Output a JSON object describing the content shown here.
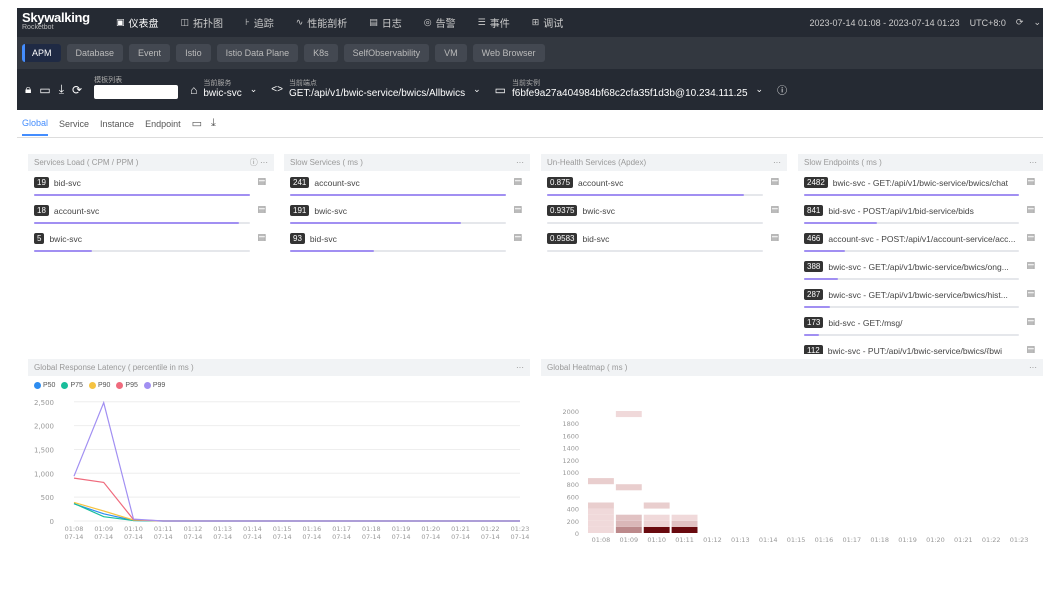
{
  "header": {
    "brand": "Skywalking",
    "brand_sub": "Rocketbot",
    "nav": [
      {
        "icon": "dashboard-icon",
        "glyph": "▣",
        "label": "仪表盘",
        "active": true
      },
      {
        "icon": "topology-icon",
        "glyph": "◫",
        "label": "拓扑图",
        "active": false
      },
      {
        "icon": "trace-icon",
        "glyph": "⊦",
        "label": "追踪",
        "active": false
      },
      {
        "icon": "profile-icon",
        "glyph": "∿",
        "label": "性能剖析",
        "active": false
      },
      {
        "icon": "log-icon",
        "glyph": "▤",
        "label": "日志",
        "active": false
      },
      {
        "icon": "alarm-icon",
        "glyph": "◎",
        "label": "告警",
        "active": false
      },
      {
        "icon": "event-icon",
        "glyph": "☰",
        "label": "事件",
        "active": false
      },
      {
        "icon": "debug-icon",
        "glyph": "⊞",
        "label": "调试",
        "active": false
      }
    ],
    "time_range": "2023-07-14 01:08 - 2023-07-14 01:23",
    "timezone": "UTC+8:0"
  },
  "layers": [
    "APM",
    "Database",
    "Event",
    "Istio",
    "Istio Data Plane",
    "K8s",
    "SelfObservability",
    "VM",
    "Web Browser"
  ],
  "selectors": {
    "service_label": "当前服务",
    "service_value": "bwic-svc",
    "endpoint_label": "当前端点",
    "endpoint_value": "GET:/api/v1/bwic-service/bwics/Allbwics",
    "instance_label": "当前实例",
    "instance_value": "f6bfe9a27a404984bf68c2cfa35f1d3b@10.234.111.25",
    "template_label": "模板列表"
  },
  "tabs": [
    "Global",
    "Service",
    "Instance",
    "Endpoint"
  ],
  "panels": {
    "services_load": {
      "title": "Services Load ( CPM / PPM )",
      "rows": [
        {
          "value": "19",
          "name": "bid-svc",
          "ratio": 1.0
        },
        {
          "value": "18",
          "name": "account-svc",
          "ratio": 0.95
        },
        {
          "value": "5",
          "name": "bwic-svc",
          "ratio": 0.27
        }
      ]
    },
    "slow_services": {
      "title": "Slow Services ( ms )",
      "rows": [
        {
          "value": "241",
          "name": "account-svc",
          "ratio": 1.0
        },
        {
          "value": "191",
          "name": "bwic-svc",
          "ratio": 0.79
        },
        {
          "value": "93",
          "name": "bid-svc",
          "ratio": 0.39
        }
      ]
    },
    "unhealth_services": {
      "title": "Un-Health Services (Apdex)",
      "rows": [
        {
          "value": "0.875",
          "name": "account-svc",
          "ratio": 0.91
        },
        {
          "value": "0.9375",
          "name": "bwic-svc",
          "ratio": 0.0
        },
        {
          "value": "0.9583",
          "name": "bid-svc",
          "ratio": 0.0
        }
      ]
    },
    "slow_endpoints": {
      "title": "Slow Endpoints ( ms )",
      "rows": [
        {
          "value": "2482",
          "name": "bwic-svc - GET:/api/v1/bwic-service/bwics/chat",
          "ratio": 1.0
        },
        {
          "value": "841",
          "name": "bid-svc - POST:/api/v1/bid-service/bids",
          "ratio": 0.34
        },
        {
          "value": "466",
          "name": "account-svc - POST:/api/v1/account-service/acc...",
          "ratio": 0.19
        },
        {
          "value": "388",
          "name": "bwic-svc - GET:/api/v1/bwic-service/bwics/ong...",
          "ratio": 0.16
        },
        {
          "value": "287",
          "name": "bwic-svc - GET:/api/v1/bwic-service/bwics/hist...",
          "ratio": 0.12
        },
        {
          "value": "173",
          "name": "bid-svc - GET:/msg/",
          "ratio": 0.07
        },
        {
          "value": "112",
          "name": "bwic-svc - PUT:/api/v1/bwic-service/bwics/{bwi",
          "ratio": 0.05
        }
      ]
    },
    "latency": {
      "title": "Global Response Latency ( percentile in ms )"
    },
    "heatmap": {
      "title": "Global Heatmap ( ms )"
    }
  },
  "chart_data": [
    {
      "type": "line",
      "title": "Global Response Latency ( percentile in ms )",
      "x": [
        "01:08\n07-14",
        "01:09\n07-14",
        "01:10\n07-14",
        "01:11\n07-14",
        "01:12\n07-14",
        "01:13\n07-14",
        "01:14\n07-14",
        "01:15\n07-14",
        "01:16\n07-14",
        "01:17\n07-14",
        "01:18\n07-14",
        "01:19\n07-14",
        "01:20\n07-14",
        "01:21\n07-14",
        "01:22\n07-14",
        "01:23\n07-14"
      ],
      "yticks": [
        0,
        500,
        1000,
        1500,
        2000,
        2500
      ],
      "ylim": [
        0,
        2600
      ],
      "series": [
        {
          "name": "P50",
          "color": "#2d8cf0",
          "values": [
            360,
            150,
            10,
            0,
            0,
            0,
            0,
            0,
            0,
            0,
            0,
            0,
            0,
            0,
            0,
            0
          ]
        },
        {
          "name": "P75",
          "color": "#19be9b",
          "values": [
            370,
            90,
            10,
            0,
            0,
            0,
            0,
            0,
            0,
            0,
            0,
            0,
            0,
            0,
            0,
            0
          ]
        },
        {
          "name": "P90",
          "color": "#f5c342",
          "values": [
            390,
            210,
            20,
            0,
            0,
            0,
            0,
            0,
            0,
            0,
            0,
            0,
            0,
            0,
            0,
            0
          ]
        },
        {
          "name": "P95",
          "color": "#ef6b7d",
          "values": [
            900,
            810,
            30,
            0,
            0,
            0,
            0,
            0,
            0,
            0,
            0,
            0,
            0,
            0,
            0,
            0
          ]
        },
        {
          "name": "P99",
          "color": "#a18ff2",
          "values": [
            940,
            2480,
            40,
            0,
            0,
            0,
            0,
            0,
            0,
            0,
            0,
            0,
            0,
            0,
            0,
            0
          ]
        }
      ]
    },
    {
      "type": "heatmap",
      "title": "Global Heatmap ( ms )",
      "x": [
        "01:08\n07-14",
        "01:09\n07-14",
        "01:10\n07-14",
        "01:11\n07-14",
        "01:12\n07-14",
        "01:13\n07-14",
        "01:14\n07-14",
        "01:15\n07-14",
        "01:16\n07-14",
        "01:17\n07-14",
        "01:18\n07-14",
        "01:19\n07-14",
        "01:20\n07-14",
        "01:21\n07-14",
        "01:22\n07-14",
        "01:23\n07-14"
      ],
      "y": [
        0,
        100,
        200,
        300,
        400,
        500,
        600,
        700,
        800,
        900,
        1000,
        1100,
        1200,
        1300,
        1400,
        1500,
        1600,
        1700,
        1800,
        1900,
        2000
      ],
      "yticks": [
        0,
        200,
        400,
        600,
        800,
        1000,
        1200,
        1400,
        1600,
        1800,
        2000
      ],
      "cells": [
        {
          "x": 0,
          "y": 0,
          "v": 0.1
        },
        {
          "x": 0,
          "y": 1,
          "v": 0.1
        },
        {
          "x": 0,
          "y": 2,
          "v": 0.1
        },
        {
          "x": 0,
          "y": 3,
          "v": 0.1
        },
        {
          "x": 0,
          "y": 4,
          "v": 0.15
        },
        {
          "x": 0,
          "y": 8,
          "v": 0.15
        },
        {
          "x": 1,
          "y": 0,
          "v": 0.45
        },
        {
          "x": 1,
          "y": 1,
          "v": 0.25
        },
        {
          "x": 1,
          "y": 2,
          "v": 0.2
        },
        {
          "x": 1,
          "y": 7,
          "v": 0.15
        },
        {
          "x": 1,
          "y": 19,
          "v": 0.1
        },
        {
          "x": 2,
          "y": 0,
          "v": 1.0
        },
        {
          "x": 2,
          "y": 1,
          "v": 0.12
        },
        {
          "x": 2,
          "y": 2,
          "v": 0.1
        },
        {
          "x": 2,
          "y": 4,
          "v": 0.15
        },
        {
          "x": 3,
          "y": 0,
          "v": 1.0
        },
        {
          "x": 3,
          "y": 1,
          "v": 0.2
        },
        {
          "x": 3,
          "y": 2,
          "v": 0.1
        }
      ]
    }
  ]
}
